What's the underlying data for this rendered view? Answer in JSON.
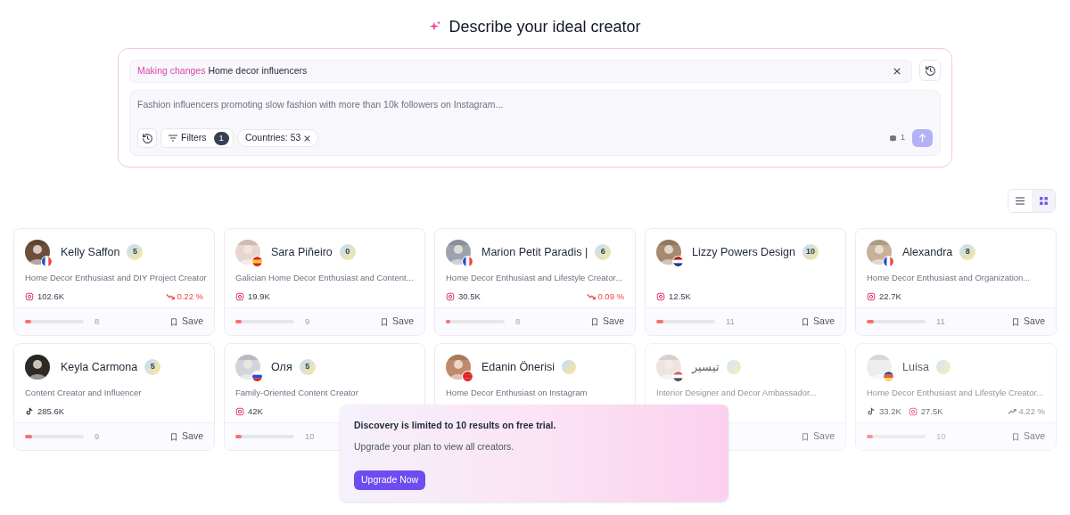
{
  "header": {
    "title": "Describe your ideal creator"
  },
  "search": {
    "editing_label": "Making changes",
    "editing_value": "Home decor influencers",
    "placeholder": "Fashion influencers promoting slow fashion with more than 10k followers on Instagram...",
    "filters_label": "Filters",
    "filters_count": "1",
    "countries_chip": "Countries: 53",
    "credits": "1"
  },
  "view_toggle": [
    {
      "kind": "list",
      "selected": false
    },
    {
      "kind": "grid",
      "selected": true
    }
  ],
  "creators": [
    {
      "name": "Kelly Saffon",
      "badge": "5",
      "bio": "Home Decor Enthusiast and DIY Project Creator",
      "stats": [
        {
          "kind": "instagram",
          "count": "102.6K"
        }
      ],
      "growth": {
        "text": "0.22 %",
        "kind": "down"
      },
      "level": 0.1,
      "score": "8",
      "save": "Save",
      "dimmed": false
    },
    {
      "name": "Sara Piñeiro",
      "badge": "0",
      "bio": "Galician Home Decor Enthusiast and Content...",
      "stats": [
        {
          "kind": "instagram",
          "count": "19.9K"
        }
      ],
      "level": 0.1,
      "score": "9",
      "save": "Save",
      "dimmed": false
    },
    {
      "name": "Marion Petit Paradis |",
      "badge": "6",
      "bio": "Home Decor Enthusiast and Lifestyle Creator...",
      "stats": [
        {
          "kind": "instagram",
          "count": "30.5K"
        }
      ],
      "growth": {
        "text": "0.09 %",
        "kind": "down"
      },
      "level": 0.08,
      "score": "8",
      "save": "Save",
      "dimmed": false
    },
    {
      "name": "Lizzy Powers Design",
      "badge": "10",
      "stats": [
        {
          "kind": "instagram",
          "count": "12.5K"
        }
      ],
      "level": 0.12,
      "score": "11",
      "save": "Save",
      "dimmed": false
    },
    {
      "name": "Alexandra",
      "badge": "8",
      "bio": "Home Decor Enthusiast and Organization...",
      "stats": [
        {
          "kind": "instagram",
          "count": "22.7K"
        }
      ],
      "level": 0.12,
      "score": "11",
      "save": "Save",
      "dimmed": false
    },
    {
      "name": "Keyla Carmona",
      "badge": "5",
      "bio": "Content Creator and Influencer",
      "stats": [
        {
          "kind": "tiktok",
          "count": "285.6K"
        }
      ],
      "level": 0.12,
      "score": "9",
      "save": "Save",
      "dimmed": false
    },
    {
      "name": "Оля",
      "badge": "5",
      "bio": "Family-Oriented Content Creator",
      "stats": [
        {
          "kind": "instagram",
          "count": "42K"
        }
      ],
      "level": 0.1,
      "score": "10",
      "dimmed": false
    },
    {
      "name": "Edanin Önerisi",
      "bio": "Home Decor Enthusiast on Instagram",
      "dimmed": false
    },
    {
      "name": "تيسير",
      "bio": "Interior Designer and Decor Ambassador...",
      "save": "Save",
      "dimmed": true
    },
    {
      "name": "Luisa",
      "bio": "Home Decor Enthusiast and Lifestyle Creator...",
      "stats": [
        {
          "kind": "tiktok",
          "count": "33.2K"
        },
        {
          "kind": "instagram",
          "count": "27.5K"
        }
      ],
      "growth": {
        "text": "4.22 %",
        "kind": "up"
      },
      "level": 0.1,
      "score": "10",
      "save": "Save",
      "dimmed": true
    }
  ],
  "upgrade": {
    "title": "Discovery is limited to 10 results on free trial.",
    "text": "Upgrade your plan to view all creators.",
    "button": "Upgrade Now"
  }
}
